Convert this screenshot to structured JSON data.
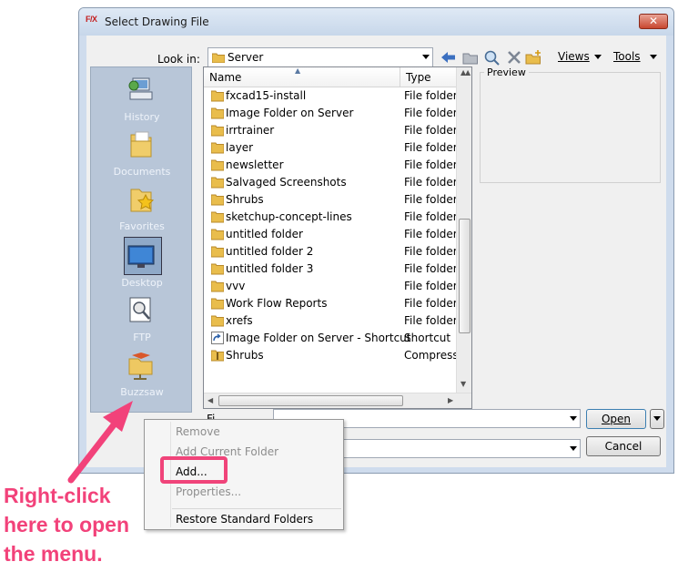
{
  "window": {
    "title": "Select Drawing File",
    "app_icon_text": "F/X",
    "close_glyph": "✕"
  },
  "toolbar": {
    "look_in_label": "Look in:",
    "look_in_value": "Server",
    "back_icon": "back-arrow-icon",
    "up_icon": "up-folder-icon",
    "search_icon": "search-web-icon",
    "delete_icon": "delete-icon",
    "new_folder_icon": "new-folder-icon",
    "views_label": "Views",
    "tools_label": "Tools"
  },
  "places": [
    {
      "label": "History",
      "icon": "history-icon"
    },
    {
      "label": "Documents",
      "icon": "documents-folder-icon"
    },
    {
      "label": "Favorites",
      "icon": "favorites-folder-icon"
    },
    {
      "label": "Desktop",
      "icon": "desktop-icon"
    },
    {
      "label": "FTP",
      "icon": "ftp-icon"
    },
    {
      "label": "Buzzsaw",
      "icon": "buzzsaw-icon"
    }
  ],
  "file_list": {
    "columns": [
      "Name",
      "Type"
    ],
    "rows": [
      {
        "name": "fxcad15-install",
        "type": "File folder",
        "icon": "folder-icon"
      },
      {
        "name": "Image Folder on Server",
        "type": "File folder",
        "icon": "folder-icon"
      },
      {
        "name": "irrtrainer",
        "type": "File folder",
        "icon": "folder-icon"
      },
      {
        "name": "layer",
        "type": "File folder",
        "icon": "folder-icon"
      },
      {
        "name": "newsletter",
        "type": "File folder",
        "icon": "folder-icon"
      },
      {
        "name": "Salvaged Screenshots",
        "type": "File folder",
        "icon": "folder-icon"
      },
      {
        "name": "Shrubs",
        "type": "File folder",
        "icon": "folder-icon"
      },
      {
        "name": "sketchup-concept-lines",
        "type": "File folder",
        "icon": "folder-icon"
      },
      {
        "name": "untitled folder",
        "type": "File folder",
        "icon": "folder-icon"
      },
      {
        "name": "untitled folder 2",
        "type": "File folder",
        "icon": "folder-icon"
      },
      {
        "name": "untitled folder 3",
        "type": "File folder",
        "icon": "folder-icon"
      },
      {
        "name": "vvv",
        "type": "File folder",
        "icon": "folder-icon"
      },
      {
        "name": "Work Flow Reports",
        "type": "File folder",
        "icon": "folder-icon"
      },
      {
        "name": "xrefs",
        "type": "File folder",
        "icon": "folder-icon"
      },
      {
        "name": "Image Folder on Server - Shortcut",
        "type": "Shortcut",
        "icon": "shortcut-icon"
      },
      {
        "name": "Shrubs",
        "type": "Compresse",
        "icon": "zip-folder-icon"
      }
    ]
  },
  "preview": {
    "label": "Preview"
  },
  "buttons": {
    "open": "Open",
    "cancel": "Cancel"
  },
  "file_name_label": "Fi",
  "context_menu": {
    "items": [
      {
        "label": "Remove",
        "enabled": false
      },
      {
        "label": "Add Current Folder",
        "enabled": false
      },
      {
        "label": "Add...",
        "enabled": true
      },
      {
        "label": "Properties...",
        "enabled": false
      },
      {
        "label": "Restore Standard Folders",
        "enabled": true
      }
    ]
  },
  "annotation": {
    "lines": [
      "Right-click",
      "here to open",
      "the menu."
    ],
    "color": "#f2427a"
  },
  "colors": {
    "places_bg": "#b8c6d8",
    "highlight": "#f0447a"
  }
}
